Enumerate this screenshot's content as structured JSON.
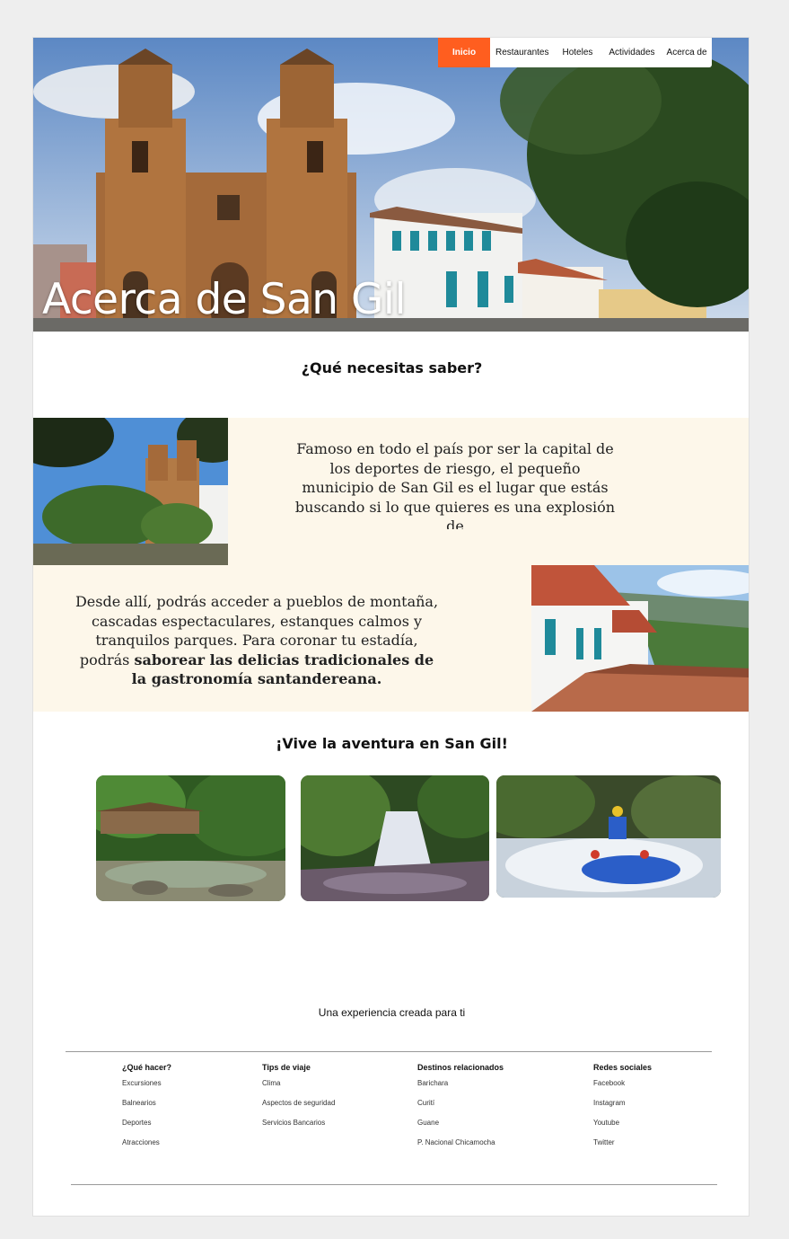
{
  "nav": {
    "items": [
      "Inicio",
      "Restaurantes",
      "Hoteles",
      "Actividades",
      "Acerca de"
    ],
    "active_index": 0
  },
  "hero": {
    "title": "Acerca de San Gil"
  },
  "sections": {
    "question_heading": "¿Qué necesitas saber?",
    "paragraph1": "Famoso en todo el país por ser la capital de los deportes de riesgo, el pequeño municipio de San Gil es el lugar que estás buscando si lo que quieres es una explosión de",
    "paragraph2_start": "Desde allí, podrás acceder a pueblos de montaña, cascadas espectaculares, estanques calmos y tranquilos parques. Para coronar tu estadía, podrás ",
    "paragraph2_bold": "saborear las delicias tradicionales de la gastronomía santandereana.",
    "adventure_heading": "¡Vive la aventura en San Gil!",
    "experience_text": "Una experiencia creada para ti"
  },
  "footer": {
    "columns": [
      {
        "title": "¿Qué hacer?",
        "links": [
          "Excursiones",
          "Balnearios",
          "Deportes",
          "Atracciones"
        ]
      },
      {
        "title": "Tips de viaje",
        "links": [
          "Clima",
          "Aspectos de seguridad",
          "Servicios Bancarios"
        ]
      },
      {
        "title": "Destinos relacionados",
        "links": [
          "Barichara",
          "Curití",
          "Guane",
          "P. Nacional Chicamocha"
        ]
      },
      {
        "title": "Redes sociales",
        "links": [
          "Facebook",
          "Instagram",
          "Youtube",
          "Twitter"
        ]
      }
    ]
  },
  "colors": {
    "accent": "#ff5e1f",
    "band": "#fdf7ea",
    "background": "#eeeeee"
  },
  "images": [
    "cathedral-hero-photo",
    "cathedral-plaza-photo",
    "colonial-street-photo",
    "bridge-river-photo",
    "waterfall-photo",
    "rafting-photo"
  ]
}
